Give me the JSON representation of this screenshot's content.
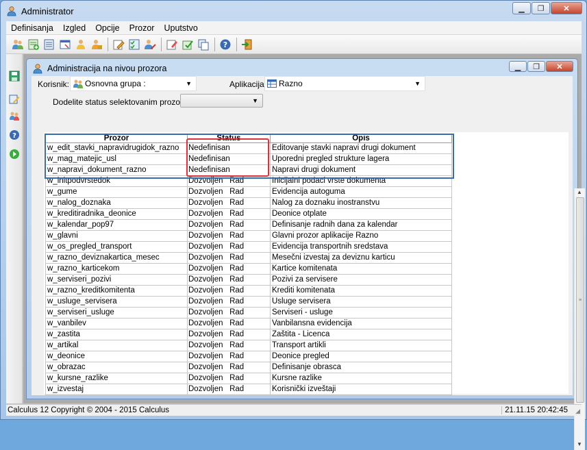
{
  "window": {
    "title": "Administrator"
  },
  "menu": [
    "Definisanja",
    "Izgled",
    "Opcije",
    "Prozor",
    "Uputstvo"
  ],
  "toolbar": {
    "icons": [
      "users-icon",
      "add-record-icon",
      "edit-record-icon",
      "window-icon",
      "copy-user-icon",
      "user-lock-icon",
      "edit-pencil-icon",
      "checklist-icon",
      "user-edit-icon",
      "note-edit-icon",
      "approve-icon",
      "forms-icon",
      "help-icon",
      "exit-icon"
    ]
  },
  "child": {
    "title": "Administracija na nivou prozora",
    "korisnik_label": "Korisnik:",
    "korisnik_value": "Osnovna grupa :",
    "aplikacija_label": "Aplikacija:",
    "aplikacija_value": "Razno",
    "assign_label": "Dodelite status selektovanim prozorima:",
    "assign_value": ""
  },
  "grid": {
    "headers": {
      "prozor": "Prozor",
      "status": "Status",
      "opis": "Opis"
    },
    "rows": [
      {
        "prozor": "w_edit_stavki_napravidrugidok_razno",
        "status": "Nedefinisan",
        "opis": "Editovanje stavki napravi drugi dokument"
      },
      {
        "prozor": "w_mag_matejic_usl",
        "status": "Nedefinisan",
        "opis": "Uporedni pregled strukture lagera"
      },
      {
        "prozor": "w_napravi_dokument_razno",
        "status": "Nedefinisan",
        "opis": "Napravi drugi dokument"
      },
      {
        "prozor": "w_initpodvrstedok",
        "status": "Dozvoljen   Rad",
        "opis": "Inicijalni podaci vrste dokumenta"
      },
      {
        "prozor": "w_gume",
        "status": "Dozvoljen   Rad",
        "opis": "Evidencija autoguma"
      },
      {
        "prozor": "w_nalog_doznaka",
        "status": "Dozvoljen   Rad",
        "opis": "Nalog za doznaku inostranstvu"
      },
      {
        "prozor": "w_kreditiradnika_deonice",
        "status": "Dozvoljen   Rad",
        "opis": "Deonice otplate"
      },
      {
        "prozor": "w_kalendar_pop97",
        "status": "Dozvoljen   Rad",
        "opis": "Definisanje radnih dana za kalendar"
      },
      {
        "prozor": "w_glavni",
        "status": "Dozvoljen   Rad",
        "opis": "Glavni prozor aplikacije Razno"
      },
      {
        "prozor": "w_os_pregled_transport",
        "status": "Dozvoljen   Rad",
        "opis": "Evidencija transportnih sredstava"
      },
      {
        "prozor": "w_razno_deviznakartica_mesec",
        "status": "Dozvoljen   Rad",
        "opis": "Mesečni izvestaj za deviznu karticu"
      },
      {
        "prozor": "w_razno_karticekom",
        "status": "Dozvoljen   Rad",
        "opis": "Kartice komitenata"
      },
      {
        "prozor": "w_serviseri_pozivi",
        "status": "Dozvoljen   Rad",
        "opis": "Pozivi za servisere"
      },
      {
        "prozor": "w_razno_kreditkomitenta",
        "status": "Dozvoljen   Rad",
        "opis": "Krediti komitenata"
      },
      {
        "prozor": "w_usluge_servisera",
        "status": "Dozvoljen   Rad",
        "opis": "Usluge servisera"
      },
      {
        "prozor": "w_serviseri_usluge",
        "status": "Dozvoljen   Rad",
        "opis": "Serviseri - usluge"
      },
      {
        "prozor": "w_vanbilev",
        "status": "Dozvoljen   Rad",
        "opis": "Vanbilansna evidencija"
      },
      {
        "prozor": "w_zastita",
        "status": "Dozvoljen   Rad",
        "opis": "Zaštita - Licenca"
      },
      {
        "prozor": "w_artikal",
        "status": "Dozvoljen   Rad",
        "opis": "Transport artikli"
      },
      {
        "prozor": "w_deonice",
        "status": "Dozvoljen   Rad",
        "opis": "Deonice pregled"
      },
      {
        "prozor": "w_obrazac",
        "status": "Dozvoljen   Rad",
        "opis": "Definisanje obrasca"
      },
      {
        "prozor": "w_kursne_razlike",
        "status": "Dozvoljen   Rad",
        "opis": "Kursne razlike"
      },
      {
        "prozor": "w_izvestaj",
        "status": "Dozvoljen   Rad",
        "opis": "Korisnički izveštaji"
      }
    ]
  },
  "statusbar": {
    "left": "Calculus 12  Copyright © 2004 - 2015  Calculus",
    "right": "21.11.15 20:42:45"
  },
  "colors": {
    "highlight_blue": "#3a6db0",
    "highlight_red": "#d9323a",
    "mdi_bg": "#ababab"
  }
}
